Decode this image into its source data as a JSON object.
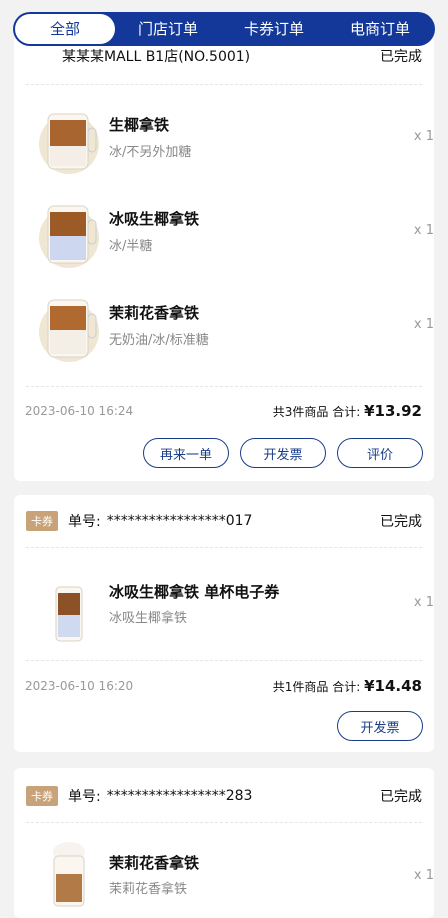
{
  "tabs": [
    {
      "label": "全部"
    },
    {
      "label": "门店订单"
    },
    {
      "label": "卡券订单"
    },
    {
      "label": "电商订单"
    }
  ],
  "orders": [
    {
      "store": "某某某MALL B1店(NO.5001)",
      "status": "已完成",
      "items": [
        {
          "name": "生椰拿铁",
          "desc": "冰/不另外加糖",
          "qty": "x 1"
        },
        {
          "name": "冰吸生椰拿铁",
          "desc": "冰/半糖",
          "qty": "x 1"
        },
        {
          "name": "茉莉花香拿铁",
          "desc": "无奶油/冰/标准糖",
          "qty": "x 1"
        }
      ],
      "date": "2023-06-10 16:24",
      "summary_prefix": "共3件商品 合计:",
      "total": "¥13.92",
      "buttons": [
        {
          "label": "再来一单"
        },
        {
          "label": "开发票"
        },
        {
          "label": "评价"
        }
      ]
    },
    {
      "badge": "卡券",
      "number_label": "单号:",
      "number": "*****************017",
      "status": "已完成",
      "items": [
        {
          "name": "冰吸生椰拿铁 单杯电子券",
          "desc": "冰吸生椰拿铁",
          "qty": "x 1"
        }
      ],
      "date": "2023-06-10 16:20",
      "summary_prefix": "共1件商品 合计:",
      "total": "¥14.48",
      "buttons": [
        {
          "label": "开发票"
        }
      ]
    },
    {
      "badge": "卡券",
      "number_label": "单号:",
      "number": "*****************283",
      "status": "已完成",
      "items": [
        {
          "name": "茉莉花香拿铁",
          "desc": "茉莉花香拿铁",
          "qty": "x 1"
        }
      ]
    }
  ],
  "colors": {
    "brand": "#13389a",
    "badge": "#c8a37a",
    "price": "#111111"
  }
}
